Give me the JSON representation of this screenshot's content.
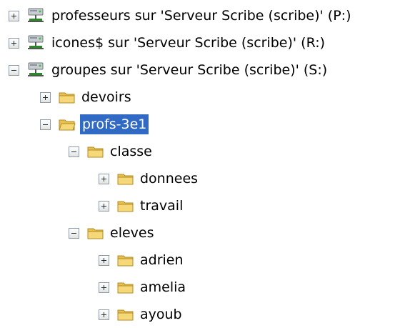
{
  "tree": {
    "drives": [
      {
        "label": "professeurs sur 'Serveur Scribe (scribe)' (P:)",
        "expanded": false,
        "icon": "network-drive-icon"
      },
      {
        "label": "icones$ sur 'Serveur Scribe (scribe)' (R:)",
        "expanded": false,
        "icon": "network-drive-icon"
      },
      {
        "label": "groupes sur 'Serveur Scribe (scribe)' (S:)",
        "expanded": true,
        "icon": "network-drive-icon"
      }
    ],
    "folders": {
      "devoirs": {
        "label": "devoirs",
        "expanded": false
      },
      "profs_3e1": {
        "label": "profs-3e1",
        "expanded": true,
        "selected": true
      },
      "classe": {
        "label": "classe",
        "expanded": true
      },
      "donnees": {
        "label": "donnees",
        "expanded": false
      },
      "travail": {
        "label": "travail",
        "expanded": false
      },
      "eleves": {
        "label": "eleves",
        "expanded": true
      },
      "adrien": {
        "label": "adrien",
        "expanded": false
      },
      "amelia": {
        "label": "amelia",
        "expanded": false
      },
      "ayoub": {
        "label": "ayoub",
        "expanded": false
      }
    }
  },
  "colors": {
    "selection": "#316ac5",
    "folder": "#f2cd5c"
  }
}
